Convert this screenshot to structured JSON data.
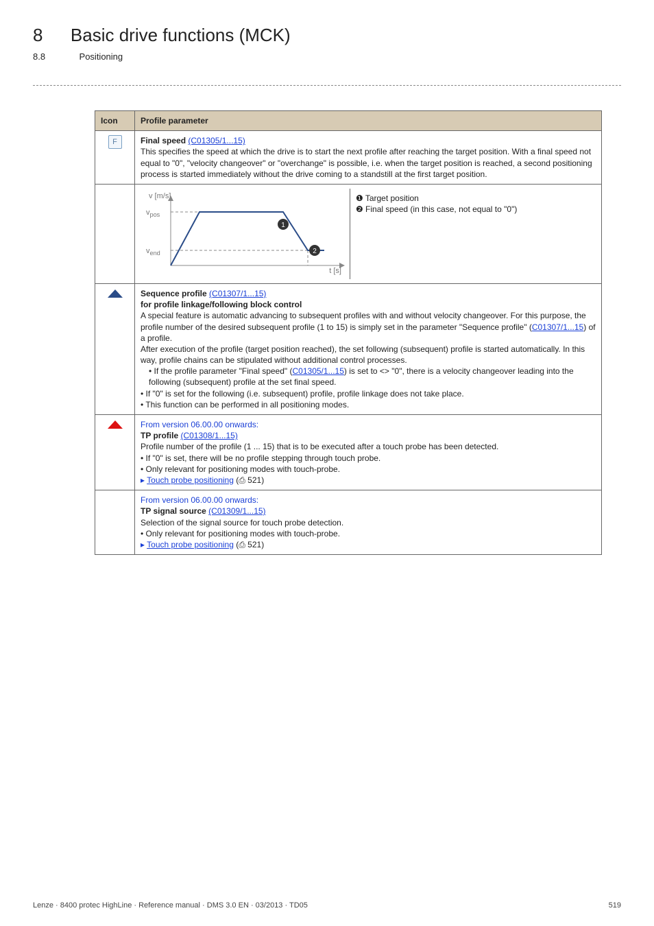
{
  "header": {
    "chapter_num": "8",
    "chapter_title": "Basic drive functions (MCK)",
    "section_num": "8.8",
    "section_title": "Positioning"
  },
  "table": {
    "col_icon": "Icon",
    "col_param": "Profile parameter"
  },
  "rows": {
    "final_speed": {
      "icon_letter": "F",
      "title": "Final speed",
      "code": "(C01305/1...15)",
      "body": "This specifies the speed at which the drive is to start the next profile after reaching the target position. With a final speed not equal to \"0\", \"velocity changeover\" or \"overchange\" is possible, i.e. when the target position is reached, a second positioning process is started immediately without the drive coming to a standstill at the first target position."
    },
    "diagram": {
      "y_label": "v [m/s]",
      "x_label": "t [s]",
      "vpos": "vpos",
      "vend": "vend",
      "pt1": "❶ Target position",
      "pt2": "❷ Final speed (in this case, not equal to \"0\")",
      "marker1": "❶",
      "marker2": "❷"
    },
    "sequence": {
      "title": "Sequence profile",
      "code": "(C01307/1...15)",
      "subtitle": "for profile linkage/following block control",
      "p1": "A special feature is automatic advancing to subsequent profiles with and without velocity changeover. For this purpose, the profile number of the desired subsequent profile (1 to 15) is simply set in the parameter \"Sequence profile\" (",
      "p1_code": "C01307/1...15",
      "p1_tail": ") of a profile.",
      "p2": "After execution of the profile (target position reached), the set following (subsequent) profile is started automatically. In this way, profile chains can be stipulated without additional control processes.",
      "b1_pre": "If the profile parameter \"Final speed\" (",
      "b1_code": "C01305/1...15",
      "b1_post": ") is set to <> \"0\", there is a velocity changeover leading into the following (subsequent) profile at the set final speed.",
      "b2": "If \"0\" is set for the following (i.e. subsequent) profile, profile linkage does not take place.",
      "b3": "This function can be performed in all positioning modes."
    },
    "tp_profile": {
      "from": "From version 06.00.00 onwards:",
      "title": "TP profile",
      "code": "(C01308/1...15)",
      "p1": "Profile number of the profile (1 ... 15) that is to be executed after a touch probe has been detected.",
      "b1": "If \"0\" is set, there will be no profile stepping through touch probe.",
      "b2": "Only relevant for positioning modes with touch-probe.",
      "link_text": "Touch probe positioning",
      "link_page": " (⎙ 521)"
    },
    "tp_signal": {
      "from": "From version 06.00.00 onwards:",
      "title": "TP signal source",
      "code": "(C01309/1...15)",
      "p1": "Selection of the signal source for touch probe detection.",
      "b1": "Only relevant for positioning modes with touch-probe.",
      "link_text": "Touch probe positioning",
      "link_page": " (⎙ 521)"
    }
  },
  "footer": {
    "left": "Lenze · 8400 protec HighLine · Reference manual · DMS 3.0 EN · 03/2013 · TD05",
    "right": "519"
  }
}
